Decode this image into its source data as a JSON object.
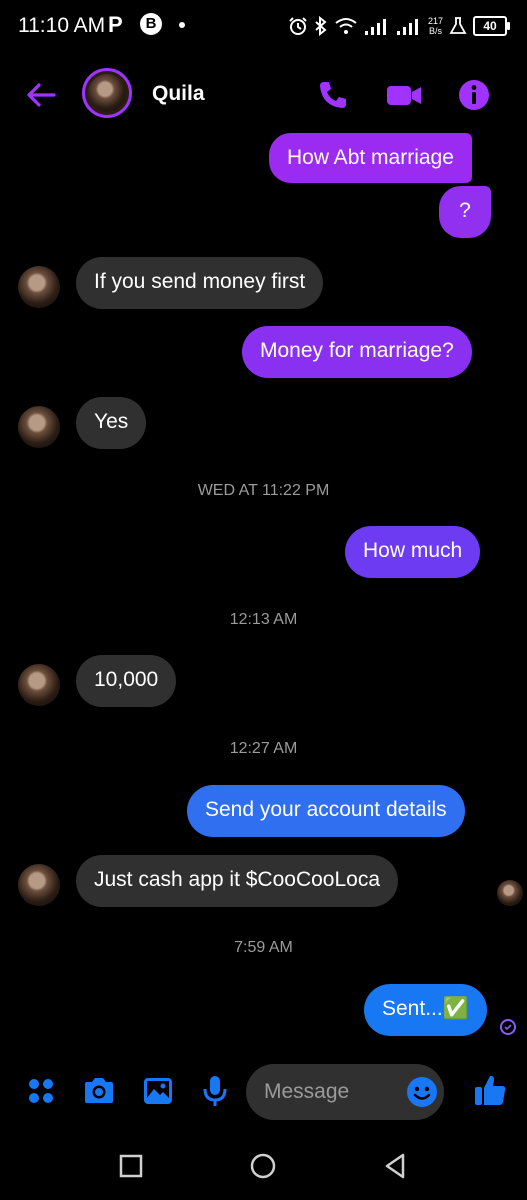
{
  "status_bar": {
    "time": "11:10 AM",
    "p_label": "P",
    "b_label": "B",
    "net_speed_top": "217",
    "net_speed_bottom": "B/s",
    "battery": "40"
  },
  "header": {
    "contact_name": "Quila",
    "accent_color": "#a033ff"
  },
  "messages": [
    {
      "direction": "out",
      "text": "How Abt marriage"
    },
    {
      "direction": "out",
      "text": "?"
    },
    {
      "direction": "in",
      "text": "If you send money first"
    },
    {
      "direction": "out",
      "text": "Money for marriage?"
    },
    {
      "direction": "in",
      "text": "Yes"
    },
    {
      "direction": "out",
      "text": "How much"
    },
    {
      "direction": "in",
      "text": "10,000"
    },
    {
      "direction": "out",
      "text": "Send your account details"
    },
    {
      "direction": "in",
      "text": "Just cash app it $CooCooLoca"
    },
    {
      "direction": "out",
      "text": "Sent...✅"
    }
  ],
  "timestamps": [
    "WED AT 11:22 PM",
    "12:13 AM",
    "12:27 AM",
    "7:59 AM"
  ],
  "composer": {
    "placeholder": "Message",
    "accent_color": "#1877f2"
  },
  "colors": {
    "gradient_top": "#9b2bf0",
    "gradient_mid": "#6d3bf2",
    "gradient_bottom": "#1877f2",
    "incoming_bubble": "#303030",
    "timestamp_text": "#9b9b9b"
  }
}
